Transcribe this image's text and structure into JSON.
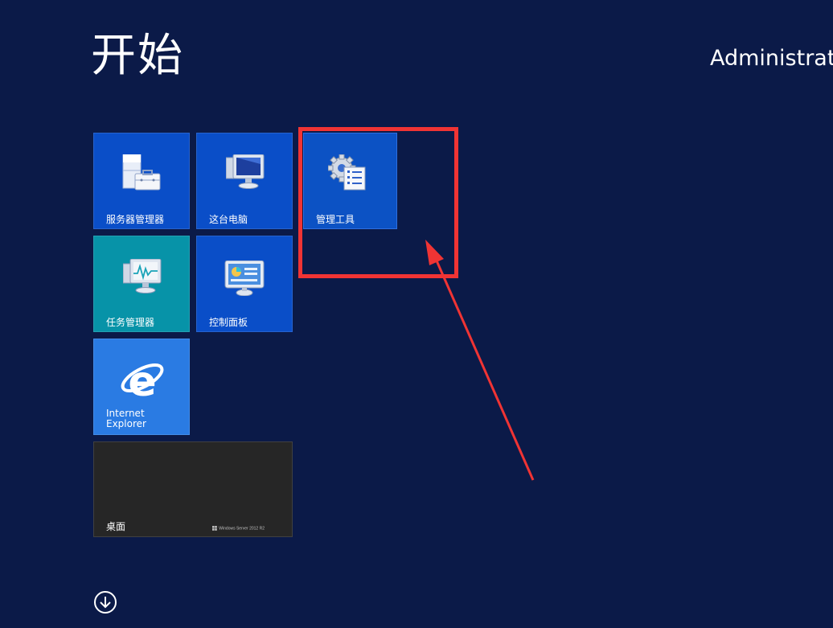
{
  "start": {
    "title": "开始",
    "user": "Administrator"
  },
  "tiles": {
    "server_manager": "服务器管理器",
    "this_pc": "这台电脑",
    "admin_tools": "管理工具",
    "task_manager": "任务管理器",
    "control_panel": "控制面板",
    "internet_explorer": "Internet\nExplorer",
    "desktop": "桌面",
    "desktop_badge": "Windows Server 2012 R2"
  },
  "colors": {
    "background": "#0b1a48",
    "tile_blue": "#0a4ec8",
    "tile_teal": "#0793a8",
    "tile_ie": "#2a7be3",
    "tile_desktop": "#262626",
    "annotation_red": "#f03434"
  },
  "icons": {
    "server_manager": "server-toolbox-icon",
    "this_pc": "computer-monitor-icon",
    "admin_tools": "gear-checklist-icon",
    "task_manager": "monitor-chart-icon",
    "control_panel": "control-panel-icon",
    "internet_explorer": "ie-logo-icon",
    "apps_view": "circle-arrow-down-icon"
  }
}
